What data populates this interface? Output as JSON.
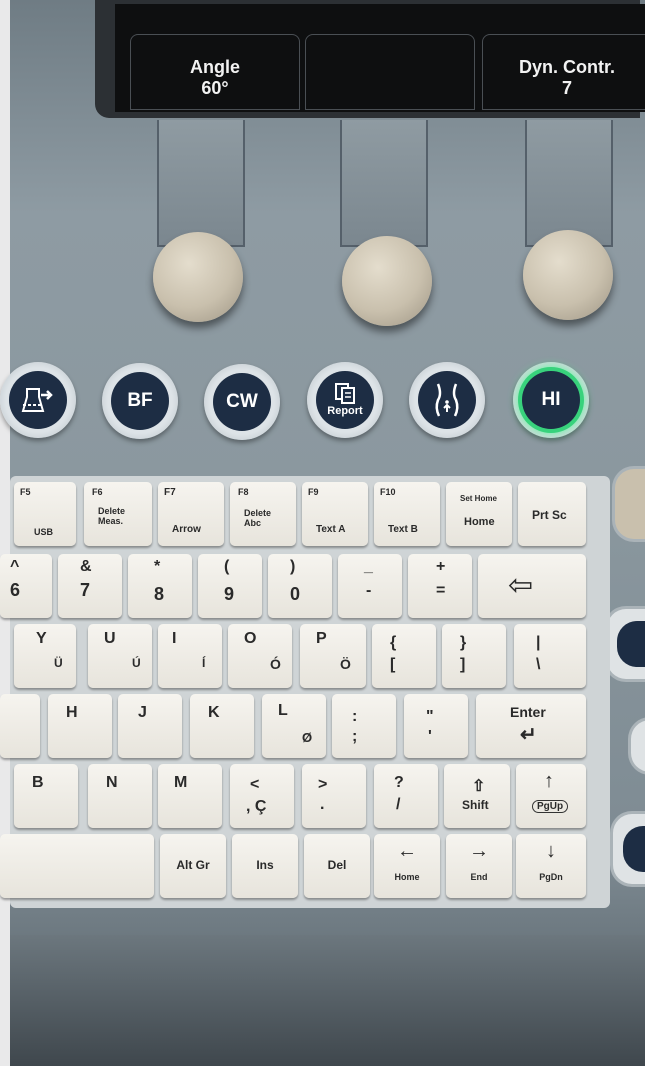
{
  "softkeys": [
    {
      "line1": "Angle",
      "line2": "60°"
    },
    {
      "line1": "",
      "line2": ""
    },
    {
      "line1": "Dyn. Contr.",
      "line2": "7"
    }
  ],
  "round_buttons": [
    {
      "label": "",
      "icon": "trapezoid-arrow-icon"
    },
    {
      "label": "BF"
    },
    {
      "label": "CW"
    },
    {
      "label": "Report",
      "icon": "report-pages-icon"
    },
    {
      "label": "",
      "icon": "torso-icon"
    },
    {
      "label": "HI",
      "lit": true,
      "lit_color": "#38d27c"
    }
  ],
  "keyboard": {
    "fn_row": [
      {
        "fkey": "F5",
        "label": "USB"
      },
      {
        "fkey": "F6",
        "label": "Delete\nMeas."
      },
      {
        "fkey": "F7",
        "label": "Arrow"
      },
      {
        "fkey": "F8",
        "label": "Delete\nAbc"
      },
      {
        "fkey": "F9",
        "label": "Text A"
      },
      {
        "fkey": "F10",
        "label": "Text B"
      },
      {
        "fkey": "Set Home",
        "label": "Home"
      },
      {
        "fkey": "",
        "label": "Prt Sc"
      }
    ],
    "num_row": [
      {
        "top": "^",
        "bottom": "6"
      },
      {
        "top": "&",
        "bottom": "7"
      },
      {
        "top": "*",
        "bottom": "8"
      },
      {
        "top": "(",
        "bottom": "9"
      },
      {
        "top": ")",
        "bottom": "0"
      },
      {
        "top": "_",
        "bottom": "-"
      },
      {
        "top": "+",
        "bottom": "="
      },
      {
        "top": "⇦",
        "bottom": ""
      }
    ],
    "row_y": [
      {
        "top": "Y",
        "bottom": "Ü"
      },
      {
        "top": "U",
        "bottom": "Ú"
      },
      {
        "top": "I",
        "bottom": "Í"
      },
      {
        "top": "O",
        "bottom": "Ó"
      },
      {
        "top": "P",
        "bottom": "Ö"
      },
      {
        "top": "{",
        "bottom": "["
      },
      {
        "top": "}",
        "bottom": "]"
      },
      {
        "top": "|",
        "bottom": "\\"
      }
    ],
    "row_h": [
      {
        "top": "H",
        "bottom": ""
      },
      {
        "top": "J",
        "bottom": ""
      },
      {
        "top": "K",
        "bottom": ""
      },
      {
        "top": "L",
        "bottom": "Ø"
      },
      {
        "top": ":",
        "bottom": ";"
      },
      {
        "top": "\"",
        "bottom": "'"
      },
      {
        "top": "Enter",
        "bottom": "↵"
      }
    ],
    "row_b": [
      {
        "top": "B",
        "bottom": ""
      },
      {
        "top": "N",
        "bottom": ""
      },
      {
        "top": "M",
        "bottom": ""
      },
      {
        "top": "<",
        "bottom": ", Ç"
      },
      {
        "top": ">",
        "bottom": "."
      },
      {
        "top": "?",
        "bottom": "/"
      },
      {
        "top": "⇧",
        "bottom": "Shift"
      },
      {
        "top": "↑",
        "bottom": "PgUp"
      }
    ],
    "bottom_row": [
      {
        "label": ""
      },
      {
        "label": "Alt Gr"
      },
      {
        "label": "Ins"
      },
      {
        "label": "Del"
      },
      {
        "top": "←",
        "bottom": "Home"
      },
      {
        "top": "→",
        "bottom": "End"
      },
      {
        "top": "↓",
        "bottom": "PgDn"
      }
    ]
  }
}
